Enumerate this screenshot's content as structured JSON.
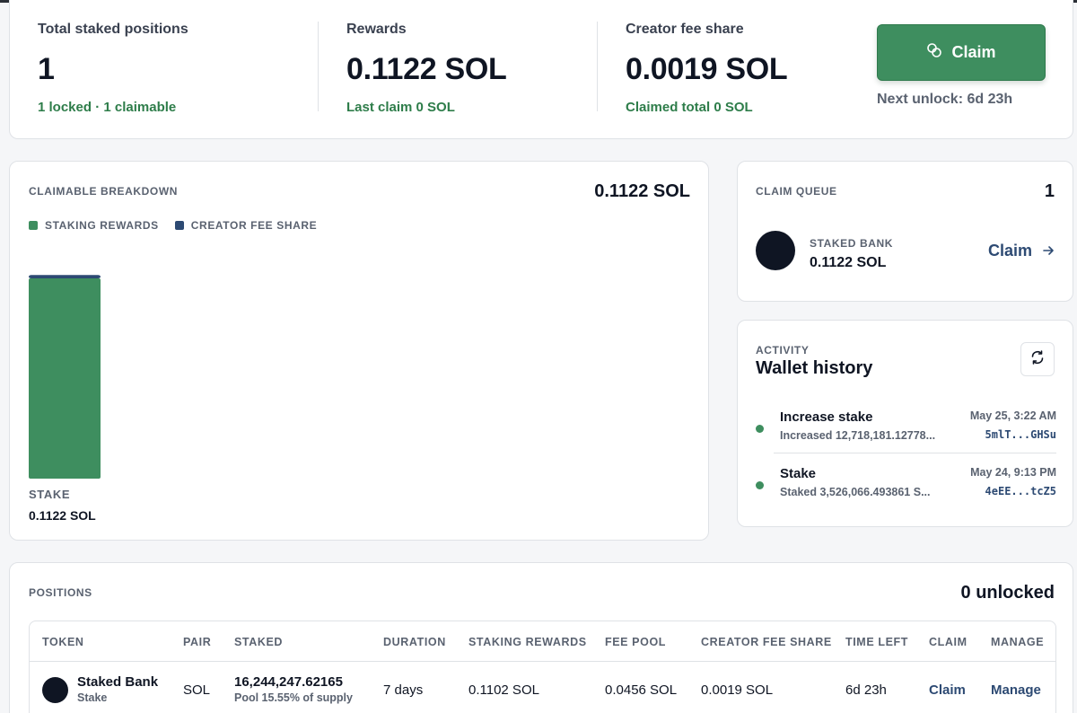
{
  "summary": {
    "total_staked": {
      "label": "Total staked positions",
      "value": "1",
      "sub": "1 locked · 1 claimable"
    },
    "rewards": {
      "label": "Rewards",
      "value": "0.1122 SOL",
      "sub": "Last claim 0 SOL"
    },
    "creator_fee": {
      "label": "Creator fee share",
      "value": "0.0019 SOL",
      "sub": "Claimed total 0 SOL"
    },
    "claim_button": "Claim",
    "next_unlock": "Next unlock: 6d 23h"
  },
  "breakdown": {
    "title": "CLAIMABLE BREAKDOWN",
    "total": "0.1122 SOL",
    "legend": [
      {
        "label": "STAKING REWARDS",
        "color": "#3e8e5f"
      },
      {
        "label": "CREATOR FEE SHARE",
        "color": "#2d4a73"
      }
    ],
    "bar_label": "STAKE",
    "bar_value": "0.1122 SOL"
  },
  "chart_data": {
    "type": "bar",
    "categories": [
      "STAKE"
    ],
    "series": [
      {
        "name": "STAKING REWARDS",
        "values": [
          0.1102
        ]
      },
      {
        "name": "CREATOR FEE SHARE",
        "values": [
          0.0019
        ]
      }
    ],
    "stacked": true,
    "ylim": [
      0,
      0.1122
    ],
    "grid": false,
    "legend_position": "top-left"
  },
  "queue": {
    "title": "CLAIM QUEUE",
    "count": "1",
    "item_label": "STAKED BANK",
    "item_value": "0.1122 SOL",
    "claim_label": "Claim"
  },
  "activity": {
    "eyebrow": "ACTIVITY",
    "title": "Wallet history",
    "items": [
      {
        "title": "Increase stake",
        "desc": "Increased 12,718,181.12778...",
        "time": "May 25, 3:22 AM",
        "hash": "5mlT...GHSu"
      },
      {
        "title": "Stake",
        "desc": "Staked 3,526,066.493861 S...",
        "time": "May 24, 9:13 PM",
        "hash": "4eEE...tcZ5"
      }
    ]
  },
  "positions": {
    "title": "POSITIONS",
    "unlocked": "0 unlocked",
    "headers": [
      "TOKEN",
      "PAIR",
      "STAKED",
      "DURATION",
      "STAKING REWARDS",
      "FEE POOL",
      "CREATOR FEE SHARE",
      "TIME LEFT",
      "CLAIM",
      "MANAGE"
    ],
    "rows": [
      {
        "token_name": "Staked Bank",
        "token_sub": "Stake",
        "pair": "SOL",
        "staked": "16,244,247.62165",
        "staked_sub": "Pool 15.55% of supply",
        "duration": "7 days",
        "staking_rewards": "0.1102 SOL",
        "fee_pool": "0.0456 SOL",
        "creator_fee_share": "0.0019 SOL",
        "time_left": "6d 23h",
        "claim": "Claim",
        "manage": "Manage"
      }
    ]
  }
}
